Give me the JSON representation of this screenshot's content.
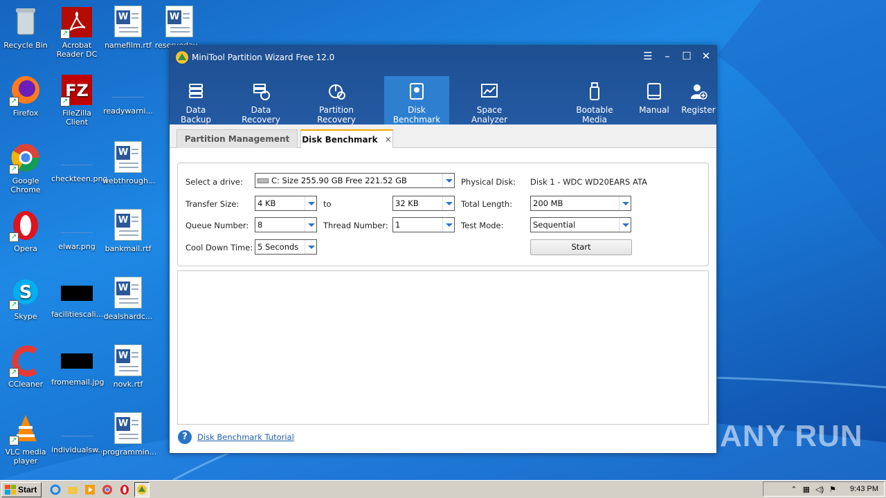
{
  "desktop": {
    "icons": [
      {
        "label": "Recycle Bin",
        "icon": "recycle-bin-icon"
      },
      {
        "label": "Acrobat Reader DC",
        "icon": "acrobat-icon"
      },
      {
        "label": "namefilm.rtf",
        "icon": "word-doc-icon"
      },
      {
        "label": "reserveday...",
        "icon": "word-doc-icon"
      },
      {
        "label": "Firefox",
        "icon": "firefox-icon"
      },
      {
        "label": "FileZilla Client",
        "icon": "filezilla-icon"
      },
      {
        "label": "readywarni...",
        "icon": "blank-file-icon"
      },
      {
        "label": "Google Chrome",
        "icon": "chrome-icon"
      },
      {
        "label": "checkteen.png",
        "icon": "blank-file-icon"
      },
      {
        "label": "webthrough...",
        "icon": "word-doc-icon"
      },
      {
        "label": "Opera",
        "icon": "opera-icon"
      },
      {
        "label": "elwar.png",
        "icon": "blank-file-icon"
      },
      {
        "label": "bankmail.rtf",
        "icon": "word-doc-icon"
      },
      {
        "label": "Skype",
        "icon": "skype-icon"
      },
      {
        "label": "facilitiescali...",
        "icon": "black-image-icon"
      },
      {
        "label": "dealshardc...",
        "icon": "word-doc-icon"
      },
      {
        "label": "CCleaner",
        "icon": "ccleaner-icon"
      },
      {
        "label": "fromemail.jpg",
        "icon": "black-image-icon"
      },
      {
        "label": "novk.rtf",
        "icon": "word-doc-icon"
      },
      {
        "label": "VLC media player",
        "icon": "vlc-icon"
      },
      {
        "label": "individualsw...",
        "icon": "blank-file-icon"
      },
      {
        "label": "programmin...",
        "icon": "word-doc-icon"
      }
    ]
  },
  "window": {
    "title": "MiniTool Partition Wizard Free 12.0",
    "toolbar": [
      {
        "label": "Data Backup",
        "icon": "data-backup-icon"
      },
      {
        "label": "Data Recovery",
        "icon": "data-recovery-icon"
      },
      {
        "label": "Partition Recovery",
        "icon": "partition-recovery-icon"
      },
      {
        "label": "Disk Benchmark",
        "icon": "disk-benchmark-icon"
      },
      {
        "label": "Space Analyzer",
        "icon": "space-analyzer-icon"
      },
      {
        "label": "Bootable Media",
        "icon": "bootable-media-icon"
      },
      {
        "label": "Manual",
        "icon": "manual-icon"
      },
      {
        "label": "Register",
        "icon": "register-icon"
      }
    ],
    "tabs": {
      "partition_management": "Partition Management",
      "disk_benchmark": "Disk Benchmark"
    },
    "form": {
      "select_drive_label": "Select a drive:",
      "select_drive_value": "C:  Size 255.90 GB  Free 221.52 GB",
      "physical_disk_label": "Physical Disk:",
      "physical_disk_value": "Disk 1 - WDC WD20EARS ATA",
      "transfer_size_label": "Transfer Size:",
      "transfer_from": "4 KB",
      "to_label": "to",
      "transfer_to": "32 KB",
      "total_length_label": "Total Length:",
      "total_length_value": "200 MB",
      "queue_number_label": "Queue Number:",
      "queue_number_value": "8",
      "thread_number_label": "Thread Number:",
      "thread_number_value": "1",
      "test_mode_label": "Test Mode:",
      "test_mode_value": "Sequential",
      "cool_down_label": "Cool Down Time:",
      "cool_down_value": "5 Seconds",
      "start_label": "Start"
    },
    "help_link": "Disk Benchmark Tutorial"
  },
  "watermark": "ANY RUN",
  "taskbar": {
    "start_label": "Start",
    "clock": "9:43 PM"
  }
}
